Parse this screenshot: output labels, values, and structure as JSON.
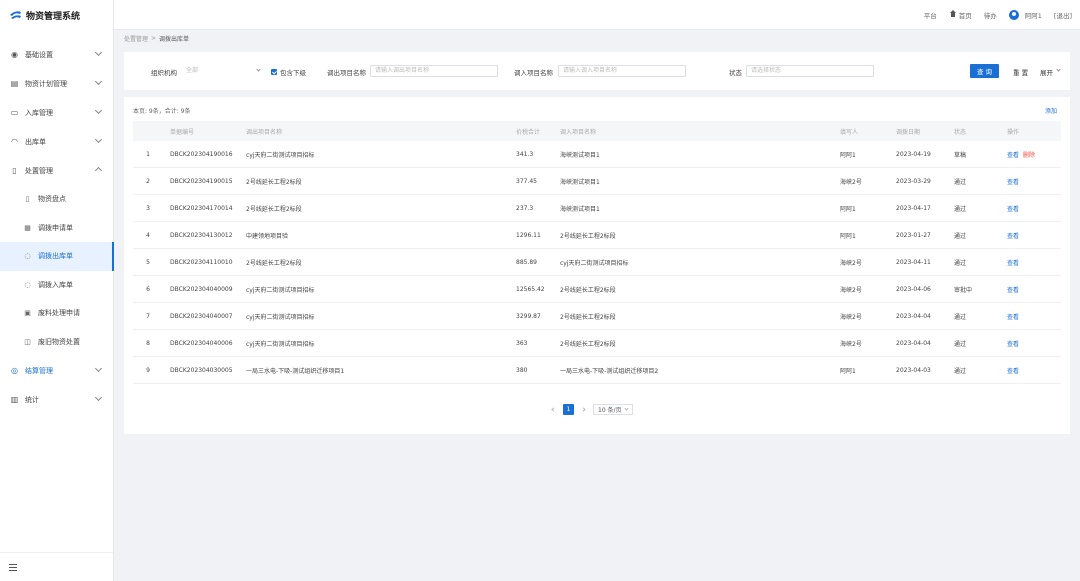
{
  "app": {
    "title": "物资管理系统"
  },
  "header": {
    "items": [
      "平台",
      "首页",
      "待办"
    ],
    "user": "阿阿1",
    "logout": "[退出]"
  },
  "sidebar": {
    "menu": [
      {
        "label": "基础设置",
        "icon": "settings-icon"
      },
      {
        "label": "物资计划管理",
        "icon": "calendar-icon"
      },
      {
        "label": "入库管理",
        "icon": "inbox-icon"
      },
      {
        "label": "出库单",
        "icon": "outbox-icon"
      },
      {
        "label": "处置管理",
        "icon": "document-icon"
      }
    ],
    "submenu": [
      {
        "label": "物资盘点",
        "icon": "clipboard-icon"
      },
      {
        "label": "调拨申请单",
        "icon": "form-icon"
      },
      {
        "label": "调拨出库单",
        "icon": "transfer-out-icon"
      },
      {
        "label": "调拨入库单",
        "icon": "transfer-in-icon"
      },
      {
        "label": "废料处理申请",
        "icon": "trash-icon"
      },
      {
        "label": "废旧物资处置",
        "icon": "recycle-icon"
      }
    ],
    "menu2": [
      {
        "label": "结算管理",
        "icon": "settlement-icon"
      },
      {
        "label": "统计",
        "icon": "chart-icon"
      }
    ]
  },
  "breadcrumb": [
    "处置管理",
    "调拨出库单"
  ],
  "search": {
    "org_label": "组织机构",
    "org_value": "全部",
    "include_sub": "包含下级",
    "out_project_label": "调出项目名称",
    "out_project_placeholder": "请输入调出项目名称",
    "in_project_label": "调入项目名称",
    "in_project_placeholder": "请输入调入项目名称",
    "status_label": "状态",
    "status_placeholder": "请选择状态",
    "query": "查 询",
    "reset": "重 置",
    "expand": "展开"
  },
  "table": {
    "summary": "本页: 9条，合计: 9条",
    "add": "添加",
    "columns": [
      "",
      "单据编号",
      "调出项目名称",
      "价税合计",
      "调入项目名称",
      "填写人",
      "调拨日期",
      "状态",
      "操作"
    ],
    "rows": [
      {
        "no": "1",
        "code": "DBCK202304190016",
        "out": "cyj天府二街测试项目招标",
        "amount": "341.3",
        "in": "海峡测试项目1",
        "writer": "阿阿1",
        "date": "2023-04-19",
        "status": "草稿",
        "view": "查看",
        "del": "删除"
      },
      {
        "no": "2",
        "code": "DBCK202304190015",
        "out": "2号线延长工程2标段",
        "amount": "377.45",
        "in": "海峡测试项目1",
        "writer": "海峡2号",
        "date": "2023-03-29",
        "status": "通过",
        "view": "查看"
      },
      {
        "no": "3",
        "code": "DBCK202304170014",
        "out": "2号线延长工程2标段",
        "amount": "237.3",
        "in": "海峡测试项目1",
        "writer": "阿阿1",
        "date": "2023-04-17",
        "status": "通过",
        "view": "查看"
      },
      {
        "no": "4",
        "code": "DBCK202304130012",
        "out": "中建领地项目验",
        "amount": "1296.11",
        "in": "2号线延长工程2标段",
        "writer": "阿阿1",
        "date": "2023-01-27",
        "status": "通过",
        "view": "查看"
      },
      {
        "no": "5",
        "code": "DBCK202304110010",
        "out": "2号线延长工程2标段",
        "amount": "885.89",
        "in": "cyj天府二街测试项目招标",
        "writer": "海峡2号",
        "date": "2023-04-11",
        "status": "通过",
        "view": "查看"
      },
      {
        "no": "6",
        "code": "DBCK202304040009",
        "out": "cyj天府二街测试项目招标",
        "amount": "12565.42",
        "in": "2号线延长工程2标段",
        "writer": "海峡2号",
        "date": "2023-04-06",
        "status": "审批中",
        "view": "查看"
      },
      {
        "no": "7",
        "code": "DBCK202304040007",
        "out": "cyj天府二街测试项目招标",
        "amount": "3299.87",
        "in": "2号线延长工程2标段",
        "writer": "海峡2号",
        "date": "2023-04-04",
        "status": "通过",
        "view": "查看"
      },
      {
        "no": "8",
        "code": "DBCK202304040006",
        "out": "cyj天府二街测试项目招标",
        "amount": "363",
        "in": "2号线延长工程2标段",
        "writer": "海峡2号",
        "date": "2023-04-04",
        "status": "通过",
        "view": "查看"
      },
      {
        "no": "9",
        "code": "DBCK202304030005",
        "out": "一局三水电-下吸-测试组织迁移项目1",
        "amount": "380",
        "in": "一局三水电-下吸-测试组织迁移项目2",
        "writer": "阿阿1",
        "date": "2023-04-03",
        "status": "通过",
        "view": "查看"
      }
    ]
  },
  "pager": {
    "current": "1",
    "size": "10 条/页"
  }
}
